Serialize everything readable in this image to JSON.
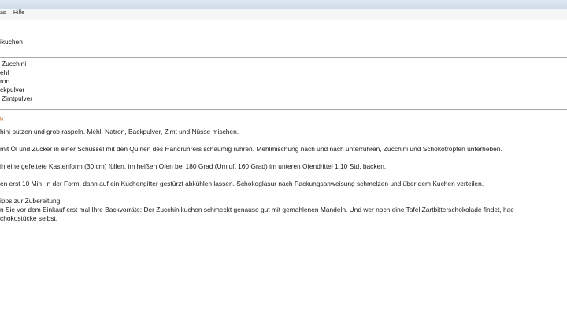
{
  "menu": {
    "item1": "as",
    "item2": "Hilfe"
  },
  "recipe": {
    "title": "ikuchen",
    "ingredients": [
      "Zucchini",
      "ehl",
      "ron",
      "ckpulver",
      "Zimtpulver"
    ],
    "section_label": "g",
    "steps": [
      "hini putzen und grob raspeln. Mehl, Natron, Backpulver, Zimt und Nüsse mischen.",
      "mit Öl und Zucker in einer Schüssel mit den Quirlen des Handrührers schaumig rühren. Mehlmischung nach und nach unterrühren, Zucchini und Schokotropfen unterheben.",
      "in eine gefettete Kastenform (30 cm) füllen, im heißen Ofen bei 180 Grad (Umluft 160 Grad) im unteren Ofendrittel 1:10 Std. backen.",
      "en erst 10 Min. in der Form, dann auf ein Kuchengitter gestürzt abkühlen lassen. Schokoglasur nach Packungsanweisung schmelzen und über dem Kuchen verteilen."
    ],
    "tips_heading": "ipps zur Zubereitung",
    "tips_line1": "n Sie vor dem Einkauf erst mal Ihre Backvorräte: Der Zucchinikuchen schmeckt genauso gut mit gemahlenen Mandeln. Und wer noch eine Tafel Zartbitterschokolade findet, hac",
    "tips_line2": "chokostücke selbst."
  }
}
